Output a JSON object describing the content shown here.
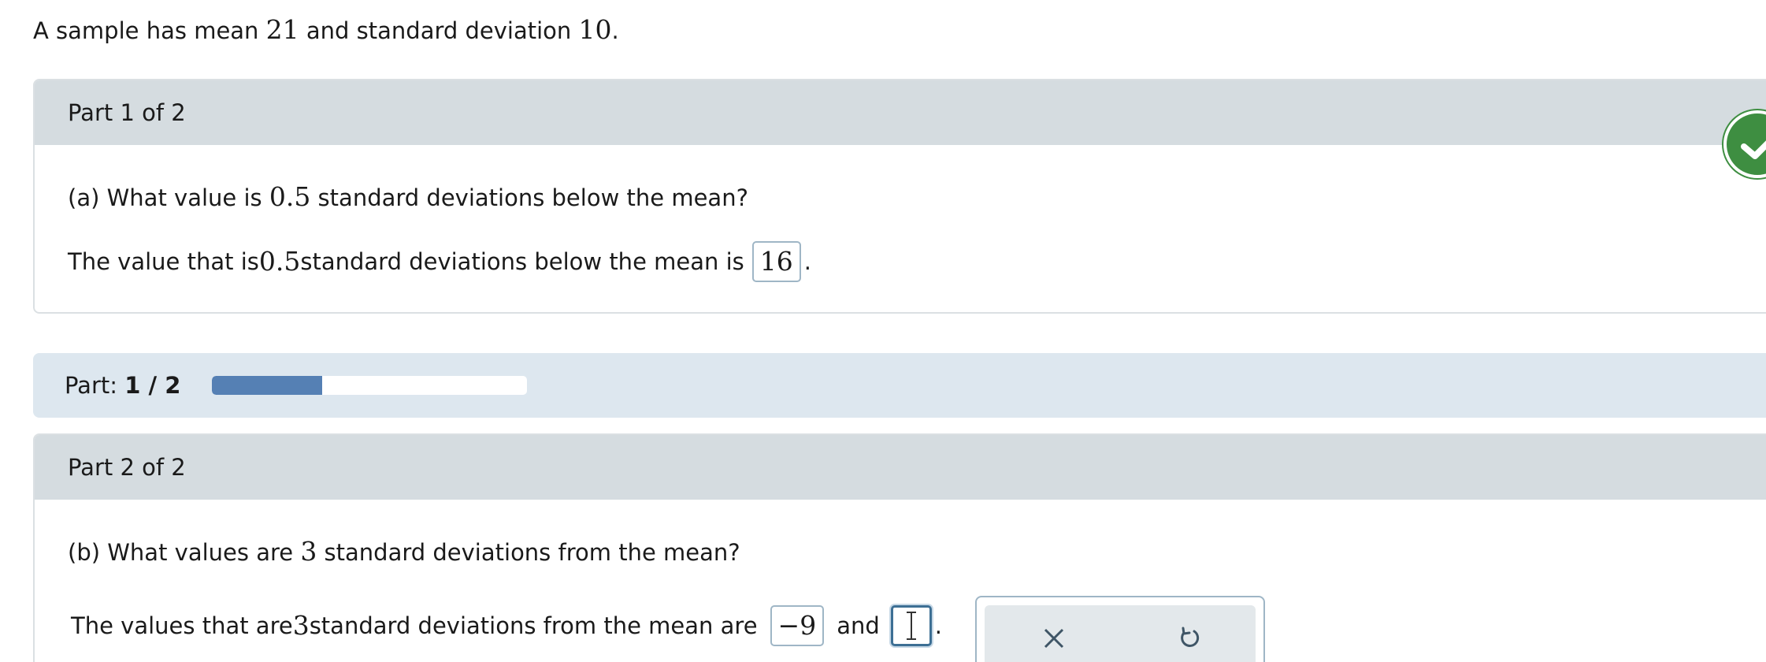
{
  "intro": {
    "prefix": "A sample has mean ",
    "mean": "21",
    "middle": " and standard deviation ",
    "sd": "10",
    "suffix": "."
  },
  "part1": {
    "header": "Part 1 of 2",
    "question_prefix": "(a) What value is ",
    "question_value": "0.5",
    "question_suffix": " standard deviations below the mean?",
    "answer_prefix": "The value that is ",
    "answer_value_text": "0.5",
    "answer_suffix": " standard deviations below the mean is",
    "answer": "16",
    "answer_end": ".",
    "status_icon": "check-icon",
    "status_color": "#3e8e41"
  },
  "progress": {
    "label": "Part:",
    "value_text": "1 / 2",
    "fraction": 0.35,
    "bar_color": "#5580b4"
  },
  "part2": {
    "header": "Part 2 of 2",
    "question_prefix": "(b) What values are ",
    "question_value": "3",
    "question_suffix": " standard deviations from the mean?",
    "answer_prefix": "The values that are ",
    "answer_value_text": "3",
    "answer_suffix": " standard deviations from the mean are",
    "answer1": "−9",
    "connector": "and",
    "answer2": "",
    "answer_end": "."
  },
  "tools": {
    "clear_icon": "close-icon",
    "undo_icon": "undo-icon"
  }
}
